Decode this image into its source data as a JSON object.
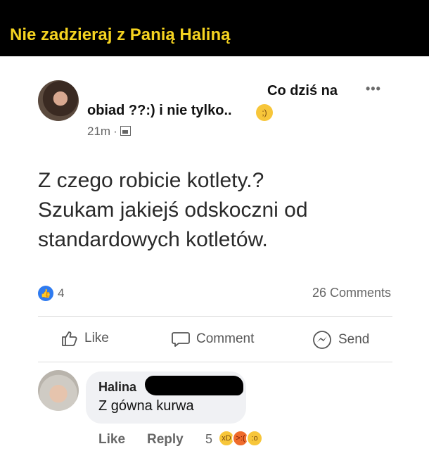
{
  "banner": {
    "title": "Nie zadzieraj z Panią Haliną"
  },
  "post": {
    "header_line1": "Co dziś na",
    "header_line2": "obiad ??:) i nie tylko..",
    "timestamp": "21m",
    "meta_separator": "·",
    "body": [
      "Z czego robicie kotlety.?",
      "Szukam jakiejś odskoczni od",
      "standardowych kotletów."
    ],
    "like_count": "4",
    "comments_count": "26 Comments",
    "actions": {
      "like": "Like",
      "comment": "Comment",
      "send": "Send"
    }
  },
  "comment": {
    "author": "Halina",
    "text": "Z gówna kurwa",
    "like": "Like",
    "reply": "Reply",
    "reaction_count": "5"
  },
  "colors": {
    "banner_bg": "#000000",
    "banner_text": "#f5d320",
    "like_blue": "#2f7bf0"
  }
}
